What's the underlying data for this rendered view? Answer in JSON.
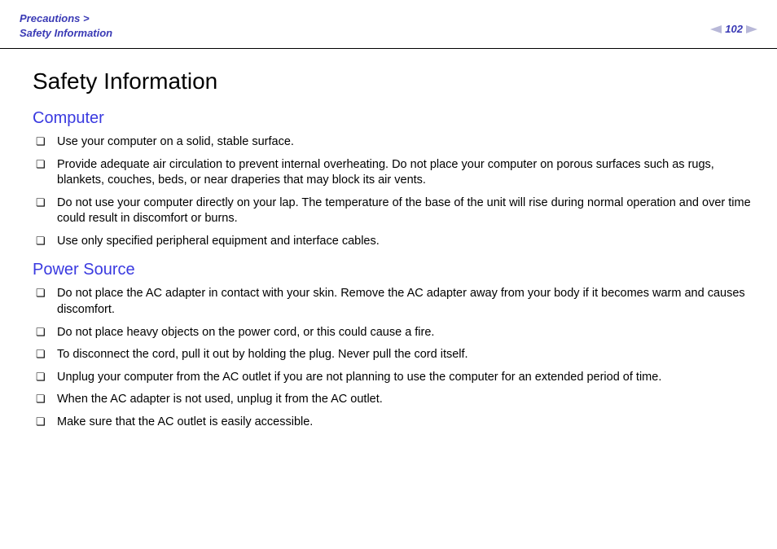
{
  "header": {
    "breadcrumb_line1": "Precautions >",
    "breadcrumb_line2": "Safety Information",
    "page_number": "102"
  },
  "title": "Safety Information",
  "sections": [
    {
      "heading": "Computer",
      "items": [
        "Use your computer on a solid, stable surface.",
        "Provide adequate air circulation to prevent internal overheating. Do not place your computer on porous surfaces such as rugs, blankets, couches, beds, or near draperies that may block its air vents.",
        "Do not use your computer directly on your lap. The temperature of the base of the unit will rise during normal operation and over time could result in discomfort or burns.",
        "Use only specified peripheral equipment and interface cables."
      ]
    },
    {
      "heading": "Power Source",
      "items": [
        "Do not place the AC adapter in contact with your skin. Remove the AC adapter away from your body if it becomes warm and causes discomfort.",
        "Do not place heavy objects on the power cord, or this could cause a fire.",
        "To disconnect the cord, pull it out by holding the plug. Never pull the cord itself.",
        "Unplug your computer from the AC outlet if you are not planning to use the computer for an extended period of time.",
        "When the AC adapter is not used, unplug it from the AC outlet.",
        "Make sure that the AC outlet is easily accessible."
      ]
    }
  ]
}
